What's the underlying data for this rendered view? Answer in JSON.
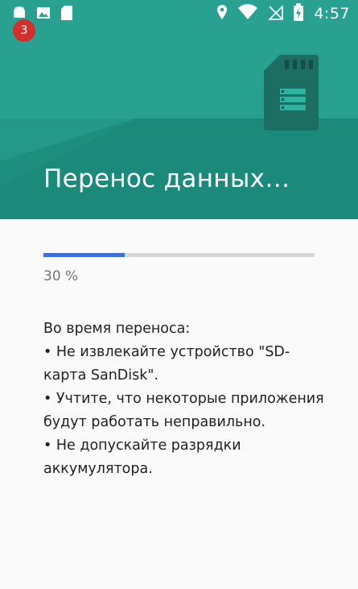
{
  "status_bar": {
    "time": "4:57",
    "notification_count": "3",
    "left_icons": [
      "android-icon",
      "image-icon",
      "sd-card-icon"
    ],
    "right_icons": [
      "location-icon",
      "wifi-icon",
      "no-sim-icon",
      "battery-charging-icon"
    ]
  },
  "header": {
    "title": "Перенос данных…",
    "illustration": "sd-card-icon",
    "colors": {
      "band_dark": "#1e8f7f",
      "band_light": "#28a08f",
      "card": "#1c6e63"
    }
  },
  "progress": {
    "value": 0.3,
    "label": "30 %",
    "fill_color": "#3f6fd8",
    "track_color": "#d6d6d6"
  },
  "message": {
    "intro": "Во время переноса:",
    "items": [
      "• Не извлекайте устройство \"SD-карта SanDisk\".",
      "• Учтите, что некоторые приложения будут работать неправильно.",
      "• Не допускайте разрядки аккумулятора."
    ]
  }
}
